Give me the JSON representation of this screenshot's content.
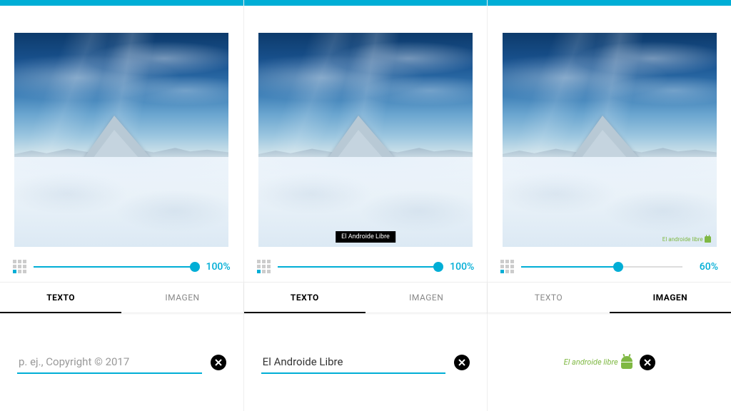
{
  "panels": [
    {
      "slider": {
        "value": 100,
        "label": "100%"
      },
      "tabs": {
        "left": "TEXTO",
        "right": "IMAGEN",
        "active": "left"
      },
      "input": {
        "type": "text",
        "value": "",
        "placeholder": "p. ej., Copyright © 2017"
      },
      "overlay": {
        "type": "none"
      }
    },
    {
      "slider": {
        "value": 100,
        "label": "100%"
      },
      "tabs": {
        "left": "TEXTO",
        "right": "IMAGEN",
        "active": "left"
      },
      "input": {
        "type": "text",
        "value": "El Androide Libre",
        "placeholder": ""
      },
      "overlay": {
        "type": "text",
        "text": "El Androide Libre"
      }
    },
    {
      "slider": {
        "value": 60,
        "label": "60%"
      },
      "tabs": {
        "left": "TEXTO",
        "right": "IMAGEN",
        "active": "right"
      },
      "input": {
        "type": "image",
        "thumb_label": "El androide libre"
      },
      "overlay": {
        "type": "image",
        "label": "El androide libre"
      }
    }
  ]
}
